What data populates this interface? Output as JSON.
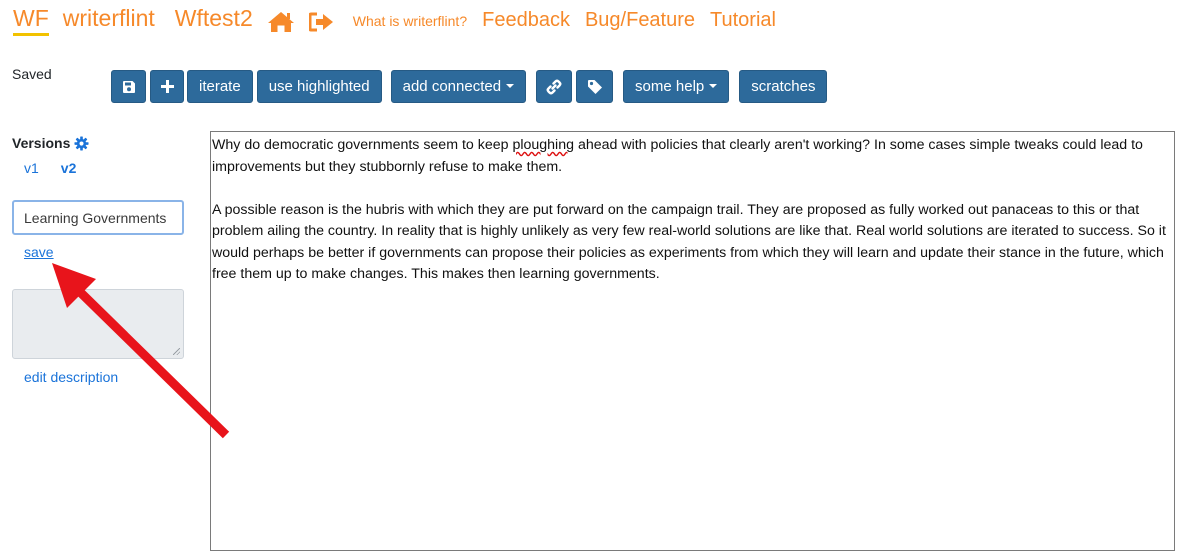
{
  "nav": {
    "logo": "WF",
    "brand": "writerflint",
    "project": "Wftest2",
    "icons": [
      "home-icon",
      "sign-out-icon"
    ],
    "what_is": "What is writerflint?",
    "links": [
      "Feedback",
      "Bug/Feature",
      "Tutorial"
    ]
  },
  "status": "Saved",
  "toolbar": {
    "save_icon": "floppy-disk-icon",
    "add_icon": "plus-icon",
    "iterate": "iterate",
    "use_highlighted": "use highlighted",
    "add_connected": "add connected",
    "link_icon": "link-icon",
    "tag_icon": "tag-icon",
    "some_help": "some help",
    "scratches": "scratches"
  },
  "sidebar": {
    "versions_title": "Versions",
    "settings_icon": "gear-icon",
    "versions": [
      {
        "label": "v1",
        "active": false
      },
      {
        "label": "v2",
        "active": true
      }
    ],
    "title_value": "Learning Governments",
    "save_link": "save",
    "description_value": "",
    "edit_description": "edit description"
  },
  "editor": {
    "paragraph1_before": "Why do democratic governments seem to keep ",
    "paragraph1_misspelled": "ploughing",
    "paragraph1_after": " ahead with policies that clearly aren't working? In some cases simple tweaks could lead to improvements but they stubbornly refuse to make them.",
    "paragraph2": "A possible reason is the hubris with which they are put forward on the campaign trail. They are proposed as fully worked out panaceas to this or that problem ailing the country. In reality that is highly unlikely as very few real-world solutions are like that. Real world solutions are iterated to success. So it would perhaps be better if governments can propose their policies as experiments from which they will learn and update their stance in the future, which free them up to make changes. This makes then learning governments."
  },
  "colors": {
    "accent_orange": "#f6892a",
    "logo_underline": "#f2c200",
    "button_blue": "#2d6a9b",
    "link_blue": "#1a73d9",
    "annotation_red": "#e8141b"
  }
}
